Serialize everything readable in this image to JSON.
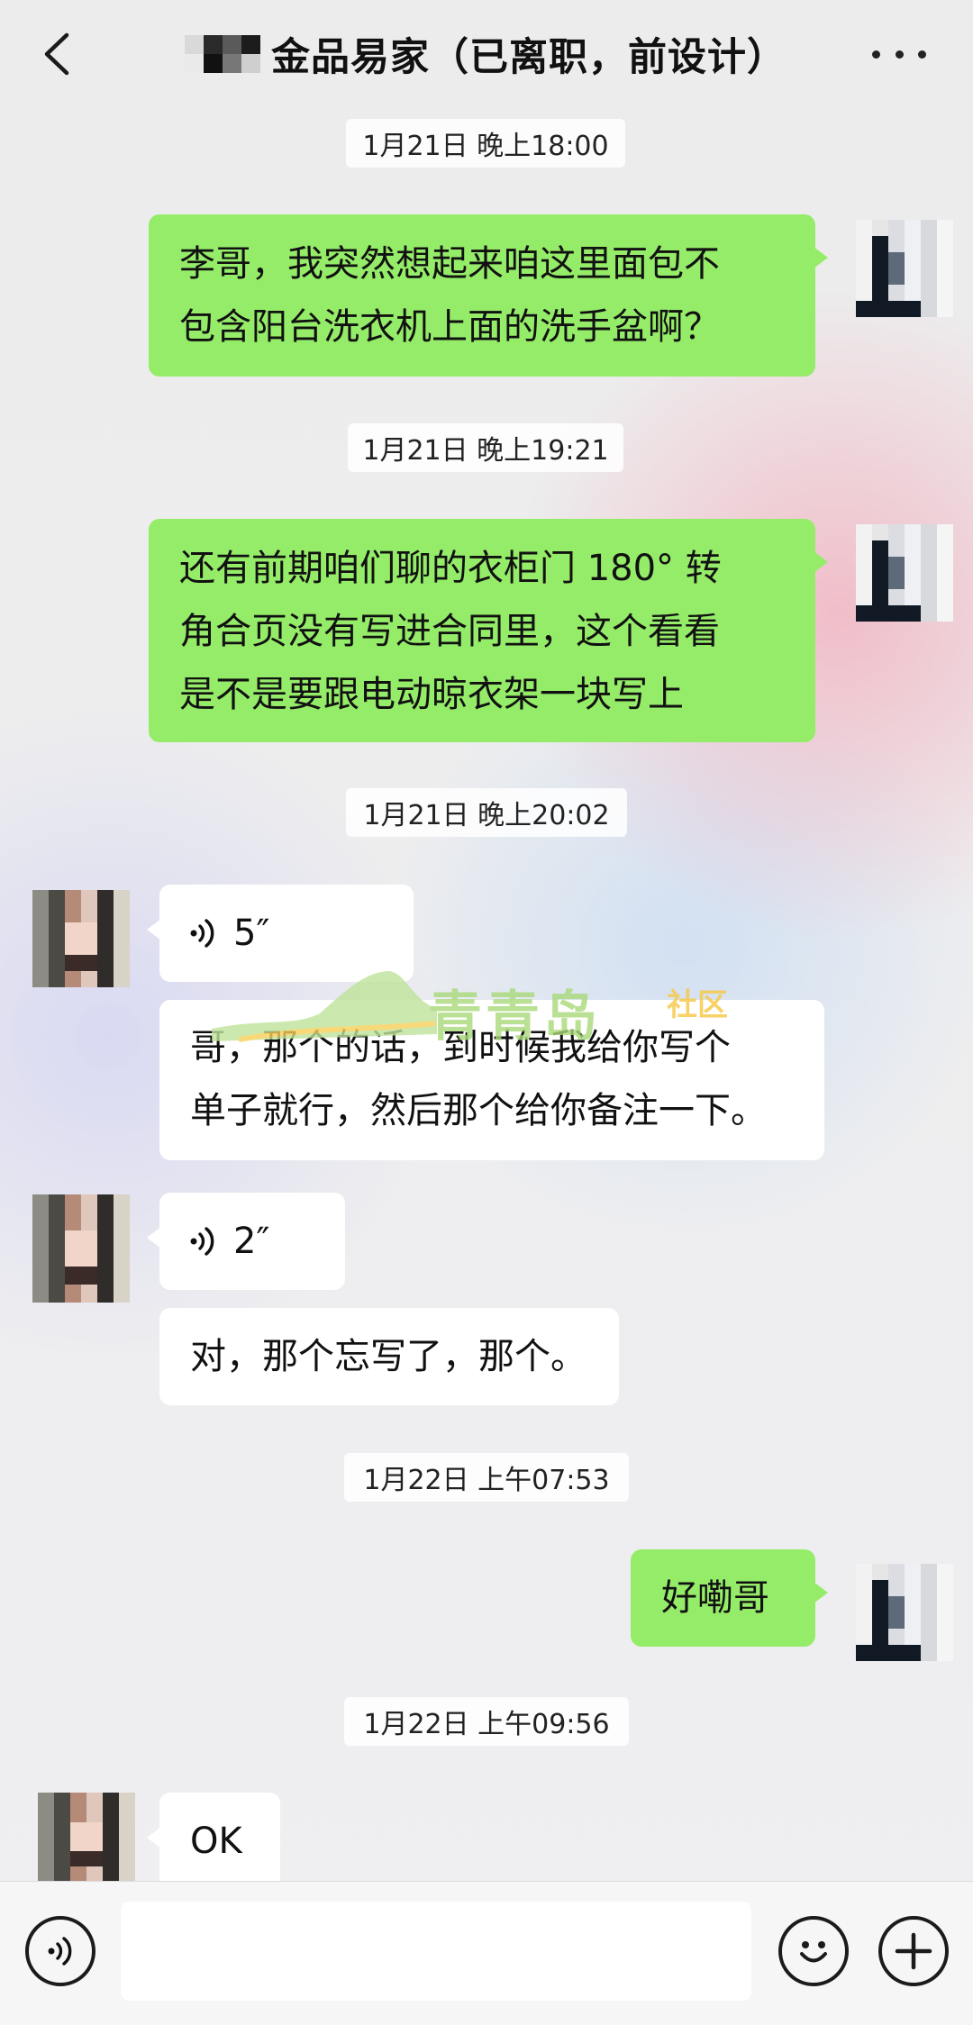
{
  "header": {
    "title": "金品易家（已离职，前设计）",
    "back_icon": "chevron-left-icon",
    "more_icon": "more-dots-icon"
  },
  "messages": [
    {
      "type": "timestamp",
      "text": "1月21日 晚上18:00"
    },
    {
      "type": "text",
      "sender": "me",
      "lines": [
        "李哥，我突然想起来咱这里面包不",
        "包含阳台洗衣机上面的洗手盆啊？"
      ]
    },
    {
      "type": "timestamp",
      "text": "1月21日 晚上19:21"
    },
    {
      "type": "text",
      "sender": "me",
      "lines": [
        "还有前期咱们聊的衣柜门 180° 转",
        "角合页没有写进合同里，这个看看",
        "是不是要跟电动晾衣架一块写上"
      ]
    },
    {
      "type": "timestamp",
      "text": "1月21日 晚上20:02"
    },
    {
      "type": "voice",
      "sender": "them",
      "duration": "5″"
    },
    {
      "type": "text",
      "sender": "them",
      "lines": [
        "哥，那个的话，到时候我给你写个",
        "单子就行，然后那个给你备注一下。"
      ]
    },
    {
      "type": "voice",
      "sender": "them",
      "duration": "2″"
    },
    {
      "type": "text",
      "sender": "them",
      "lines": [
        "对，那个忘写了，那个。"
      ]
    },
    {
      "type": "timestamp",
      "text": "1月22日 上午07:53"
    },
    {
      "type": "text",
      "sender": "me",
      "lines": [
        "好嘞哥"
      ]
    },
    {
      "type": "timestamp",
      "text": "1月22日 上午09:56"
    },
    {
      "type": "text",
      "sender": "them",
      "lines": [
        "OK"
      ]
    }
  ],
  "watermark": {
    "text": "青青岛",
    "sub": "社区"
  },
  "input": {
    "placeholder": "",
    "value": ""
  },
  "bottom_bar": {
    "voice_icon": "voice-input-icon",
    "emoji_icon": "emoji-icon",
    "plus_icon": "plus-icon"
  },
  "colors": {
    "my_bubble": "#95ec69",
    "their_bubble": "#ffffff",
    "background": "#ededed"
  }
}
